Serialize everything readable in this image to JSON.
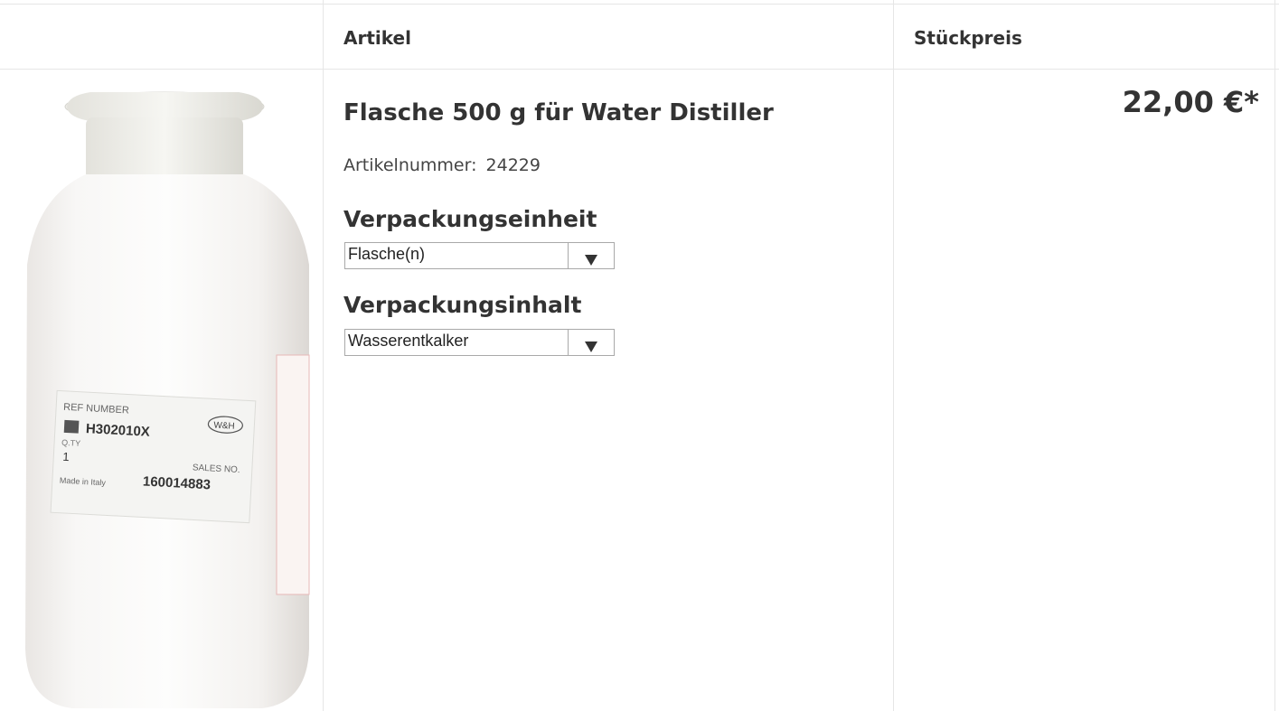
{
  "table": {
    "headers": {
      "image": "",
      "article": "Artikel",
      "unit_price": "Stückpreis"
    }
  },
  "product": {
    "image_alt": "Flasche 500 g",
    "label": {
      "ref_number_label": "REF NUMBER",
      "ref_number": "H302010X",
      "brand": "W&H",
      "qty_label": "Q.TY",
      "qty": "1",
      "sales_no_label": "SALES NO.",
      "sales_no": "160014883",
      "made_in": "Made in Italy"
    },
    "title": "Flasche 500 g für Water Distiller",
    "article_number_label": "Artikelnummer:",
    "article_number": "24229",
    "packaging_unit_label": "Verpackungseinheit",
    "packaging_unit_value": "Flasche(n)",
    "packaging_content_label": "Verpackungsinhalt",
    "packaging_content_value": "Wasserentkalker",
    "price": "22,00 €*"
  },
  "icons": {
    "select_arrow": "chevron-down-icon"
  }
}
